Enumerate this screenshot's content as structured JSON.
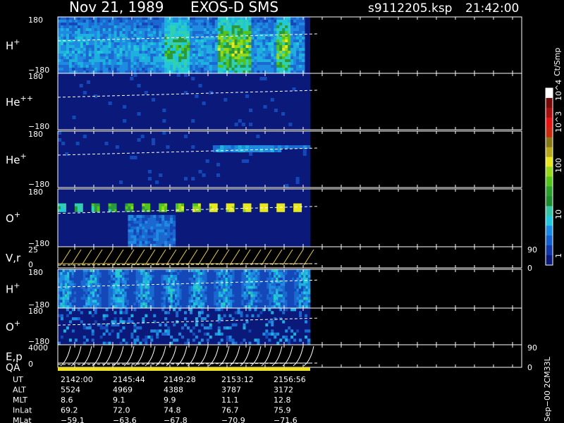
{
  "header": {
    "date": "Nov 21, 1989",
    "mission": "EXOS-D SMS",
    "file": "s9112205.ksp",
    "time": "21:42:00"
  },
  "colorbar": {
    "title": "Ct/Smp",
    "ticks": [
      "1",
      "10",
      "100",
      "10^3",
      "10^4"
    ],
    "colors": [
      "#0b1a7a",
      "#1038a8",
      "#1560d0",
      "#1a8ae8",
      "#20c8e0",
      "#36c6a4",
      "#1d8b2e",
      "#2aa02e",
      "#52c41c",
      "#98d81a",
      "#e8e81c",
      "#b8a81c",
      "#887818",
      "#cc2a10",
      "#e81414",
      "#a81010",
      "#7a0a0a",
      "#ffffff"
    ]
  },
  "panels": [
    {
      "id": "h-plus",
      "label": "H",
      "sup": "+",
      "top": "180",
      "bottom": "−180"
    },
    {
      "id": "he-pp",
      "label": "He",
      "sup": "++",
      "top": "180",
      "bottom": "−180"
    },
    {
      "id": "he-plus",
      "label": "He",
      "sup": "+",
      "top": "180",
      "bottom": "−180"
    },
    {
      "id": "o-plus",
      "label": "O",
      "sup": "+",
      "top": "180",
      "bottom": "−180"
    },
    {
      "id": "vr",
      "label": "V,r",
      "sup": "",
      "top": "25",
      "bottom": "0",
      "right_top": "90",
      "right_bottom": "0"
    },
    {
      "id": "h-plus-2",
      "label": "H",
      "sup": "+",
      "top": "180",
      "bottom": "−180"
    },
    {
      "id": "o-plus-2",
      "label": "O",
      "sup": "+",
      "top": "180",
      "bottom": "−180"
    },
    {
      "id": "ep",
      "label": "E,p",
      "sup": "",
      "top": "4000",
      "bottom": "0",
      "right_top": "90",
      "right_bottom": "0"
    }
  ],
  "qa_label": "QA",
  "footer": {
    "rows": [
      {
        "label": "UT",
        "values": [
          "2142:00",
          "2145:44",
          "2149:28",
          "2153:12",
          "2156:56"
        ]
      },
      {
        "label": "ALT",
        "values": [
          "5524",
          "4969",
          "4388",
          "3787",
          "3172"
        ]
      },
      {
        "label": "MLT",
        "values": [
          "8.6",
          "9.1",
          "9.9",
          "11.1",
          "12.8"
        ]
      },
      {
        "label": "InLat",
        "values": [
          "69.2",
          "72.0",
          "74.8",
          "76.7",
          "75.9"
        ]
      },
      {
        "label": "MLat",
        "values": [
          "−59.1",
          "−63.6",
          "−67.8",
          "−70.9",
          "−71.6"
        ]
      }
    ],
    "vertical_note": "Sep−00  2CM33L"
  },
  "chart_data": {
    "type": "heatmap",
    "title": "Nov 21, 1989   EXOS-D SMS",
    "x": [
      "2142:00",
      "2145:44",
      "2149:28",
      "2153:12",
      "2156:56"
    ],
    "xlabel": "UT",
    "panels": [
      "H+",
      "He++",
      "He+",
      "O+",
      "V,r",
      "H+",
      "O+",
      "E,p"
    ],
    "colorbar_label": "Ct/Smp",
    "colorbar_range": [
      1,
      10000
    ],
    "log_scale": true
  }
}
